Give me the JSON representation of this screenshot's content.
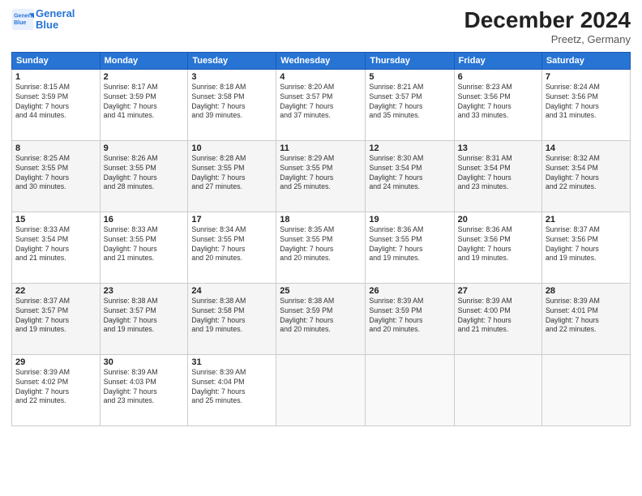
{
  "logo": {
    "line1": "General",
    "line2": "Blue"
  },
  "title": "December 2024",
  "subtitle": "Preetz, Germany",
  "header_days": [
    "Sunday",
    "Monday",
    "Tuesday",
    "Wednesday",
    "Thursday",
    "Friday",
    "Saturday"
  ],
  "weeks": [
    [
      {
        "day": "1",
        "info": "Sunrise: 8:15 AM\nSunset: 3:59 PM\nDaylight: 7 hours\nand 44 minutes."
      },
      {
        "day": "2",
        "info": "Sunrise: 8:17 AM\nSunset: 3:59 PM\nDaylight: 7 hours\nand 41 minutes."
      },
      {
        "day": "3",
        "info": "Sunrise: 8:18 AM\nSunset: 3:58 PM\nDaylight: 7 hours\nand 39 minutes."
      },
      {
        "day": "4",
        "info": "Sunrise: 8:20 AM\nSunset: 3:57 PM\nDaylight: 7 hours\nand 37 minutes."
      },
      {
        "day": "5",
        "info": "Sunrise: 8:21 AM\nSunset: 3:57 PM\nDaylight: 7 hours\nand 35 minutes."
      },
      {
        "day": "6",
        "info": "Sunrise: 8:23 AM\nSunset: 3:56 PM\nDaylight: 7 hours\nand 33 minutes."
      },
      {
        "day": "7",
        "info": "Sunrise: 8:24 AM\nSunset: 3:56 PM\nDaylight: 7 hours\nand 31 minutes."
      }
    ],
    [
      {
        "day": "8",
        "info": "Sunrise: 8:25 AM\nSunset: 3:55 PM\nDaylight: 7 hours\nand 30 minutes."
      },
      {
        "day": "9",
        "info": "Sunrise: 8:26 AM\nSunset: 3:55 PM\nDaylight: 7 hours\nand 28 minutes."
      },
      {
        "day": "10",
        "info": "Sunrise: 8:28 AM\nSunset: 3:55 PM\nDaylight: 7 hours\nand 27 minutes."
      },
      {
        "day": "11",
        "info": "Sunrise: 8:29 AM\nSunset: 3:55 PM\nDaylight: 7 hours\nand 25 minutes."
      },
      {
        "day": "12",
        "info": "Sunrise: 8:30 AM\nSunset: 3:54 PM\nDaylight: 7 hours\nand 24 minutes."
      },
      {
        "day": "13",
        "info": "Sunrise: 8:31 AM\nSunset: 3:54 PM\nDaylight: 7 hours\nand 23 minutes."
      },
      {
        "day": "14",
        "info": "Sunrise: 8:32 AM\nSunset: 3:54 PM\nDaylight: 7 hours\nand 22 minutes."
      }
    ],
    [
      {
        "day": "15",
        "info": "Sunrise: 8:33 AM\nSunset: 3:54 PM\nDaylight: 7 hours\nand 21 minutes."
      },
      {
        "day": "16",
        "info": "Sunrise: 8:33 AM\nSunset: 3:55 PM\nDaylight: 7 hours\nand 21 minutes."
      },
      {
        "day": "17",
        "info": "Sunrise: 8:34 AM\nSunset: 3:55 PM\nDaylight: 7 hours\nand 20 minutes."
      },
      {
        "day": "18",
        "info": "Sunrise: 8:35 AM\nSunset: 3:55 PM\nDaylight: 7 hours\nand 20 minutes."
      },
      {
        "day": "19",
        "info": "Sunrise: 8:36 AM\nSunset: 3:55 PM\nDaylight: 7 hours\nand 19 minutes."
      },
      {
        "day": "20",
        "info": "Sunrise: 8:36 AM\nSunset: 3:56 PM\nDaylight: 7 hours\nand 19 minutes."
      },
      {
        "day": "21",
        "info": "Sunrise: 8:37 AM\nSunset: 3:56 PM\nDaylight: 7 hours\nand 19 minutes."
      }
    ],
    [
      {
        "day": "22",
        "info": "Sunrise: 8:37 AM\nSunset: 3:57 PM\nDaylight: 7 hours\nand 19 minutes."
      },
      {
        "day": "23",
        "info": "Sunrise: 8:38 AM\nSunset: 3:57 PM\nDaylight: 7 hours\nand 19 minutes."
      },
      {
        "day": "24",
        "info": "Sunrise: 8:38 AM\nSunset: 3:58 PM\nDaylight: 7 hours\nand 19 minutes."
      },
      {
        "day": "25",
        "info": "Sunrise: 8:38 AM\nSunset: 3:59 PM\nDaylight: 7 hours\nand 20 minutes."
      },
      {
        "day": "26",
        "info": "Sunrise: 8:39 AM\nSunset: 3:59 PM\nDaylight: 7 hours\nand 20 minutes."
      },
      {
        "day": "27",
        "info": "Sunrise: 8:39 AM\nSunset: 4:00 PM\nDaylight: 7 hours\nand 21 minutes."
      },
      {
        "day": "28",
        "info": "Sunrise: 8:39 AM\nSunset: 4:01 PM\nDaylight: 7 hours\nand 22 minutes."
      }
    ],
    [
      {
        "day": "29",
        "info": "Sunrise: 8:39 AM\nSunset: 4:02 PM\nDaylight: 7 hours\nand 22 minutes."
      },
      {
        "day": "30",
        "info": "Sunrise: 8:39 AM\nSunset: 4:03 PM\nDaylight: 7 hours\nand 23 minutes."
      },
      {
        "day": "31",
        "info": "Sunrise: 8:39 AM\nSunset: 4:04 PM\nDaylight: 7 hours\nand 25 minutes."
      },
      {
        "day": "",
        "info": ""
      },
      {
        "day": "",
        "info": ""
      },
      {
        "day": "",
        "info": ""
      },
      {
        "day": "",
        "info": ""
      }
    ]
  ]
}
